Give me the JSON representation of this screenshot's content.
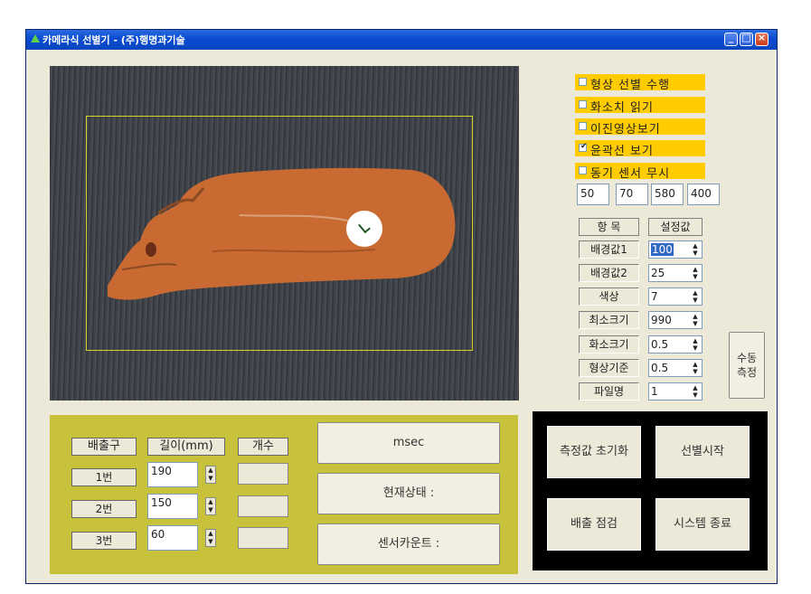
{
  "window": {
    "title": "카메라식 선별기 - (주)행명과기술"
  },
  "options": [
    {
      "label": "형상 선별 수행",
      "checked": false
    },
    {
      "label": "화소치 읽기",
      "checked": false
    },
    {
      "label": "이진영상보기",
      "checked": false
    },
    {
      "label": "윤곽선 보기",
      "checked": true
    },
    {
      "label": "동기 센서 무시",
      "checked": false
    }
  ],
  "roi_values": [
    "50",
    "70",
    "580",
    "400"
  ],
  "settings": {
    "header_item": "항 목",
    "header_value": "설정값",
    "rows": [
      {
        "label": "배경값1",
        "value": "100"
      },
      {
        "label": "배경값2",
        "value": "25"
      },
      {
        "label": "색상",
        "value": "7"
      },
      {
        "label": "최소크기",
        "value": "990"
      },
      {
        "label": "화소크기",
        "value": "0.5"
      },
      {
        "label": "형상기준",
        "value": "0.5"
      },
      {
        "label": "파일명",
        "value": "1"
      }
    ],
    "manual_button": "수동\n측정"
  },
  "outlets": {
    "headers": [
      "배출구",
      "길이(mm)",
      "개수"
    ],
    "rows": [
      {
        "label": "1번",
        "length": "190",
        "count": ""
      },
      {
        "label": "2번",
        "length": "150",
        "count": ""
      },
      {
        "label": "3번",
        "length": "60",
        "count": ""
      }
    ]
  },
  "status": {
    "msec": "msec",
    "current": "현재상태 :",
    "sensor_count": "센서카운트 :"
  },
  "actions": {
    "reset": "측정값 초기화",
    "start": "선별시작",
    "check": "배출 점검",
    "exit": "시스템 종료"
  },
  "colors": {
    "option_highlight": "#ffcc00",
    "bottom_panel": "#c8c13a",
    "roi_outline": "#d6d22a",
    "carrot": "#c96a32"
  }
}
